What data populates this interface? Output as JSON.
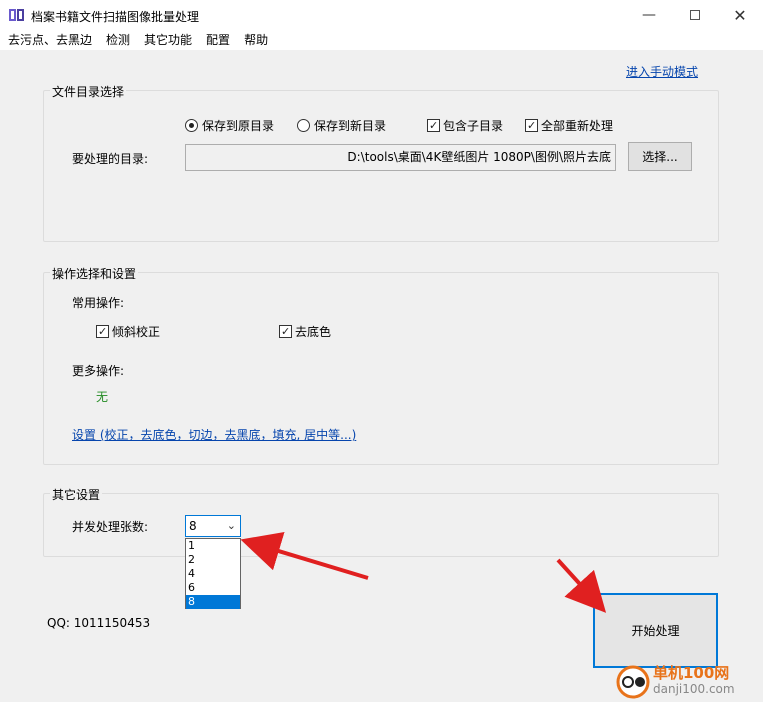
{
  "window": {
    "title": "档案书籍文件扫描图像批量处理",
    "minimize_icon": "minimize-icon",
    "maximize_icon": "maximize-icon",
    "close_icon": "close-icon"
  },
  "menu": [
    "去污点、去黑边",
    "检测",
    "其它功能",
    "配置",
    "帮助"
  ],
  "manual_mode_link": "进入手动模式",
  "dir_group": {
    "title": "文件目录选择",
    "save_original": "保存到原目录",
    "save_new": "保存到新目录",
    "include_subdirs": "包含子目录",
    "reprocess_all": "全部重新处理",
    "dir_label": "要处理的目录:",
    "dir_value": "D:\\tools\\桌面\\4K壁纸图片 1080P\\图例\\照片去底",
    "browse_button": "选择..."
  },
  "ops_group": {
    "title": "操作选择和设置",
    "common_label": "常用操作:",
    "deskew": "倾斜校正",
    "remove_bg": "去底色",
    "more_label": "更多操作:",
    "more_value": "无",
    "settings_link": "设置 (校正，去底色，切边，去黑底，填充, 居中等...)"
  },
  "other_group": {
    "title": "其它设置",
    "concurrency_label": "并发处理张数:",
    "concurrency_value": "8",
    "options": [
      "1",
      "2",
      "4",
      "6",
      "8"
    ]
  },
  "qq": "QQ: 1011150453",
  "start_button": "开始处理",
  "watermark": {
    "name": "单机100网",
    "url": "danji100.com"
  },
  "colors": {
    "accent": "#0078d7",
    "link": "#0645ad",
    "green": "#228b22",
    "arrow": "#e02020",
    "watermark_orange": "#e8731a"
  }
}
